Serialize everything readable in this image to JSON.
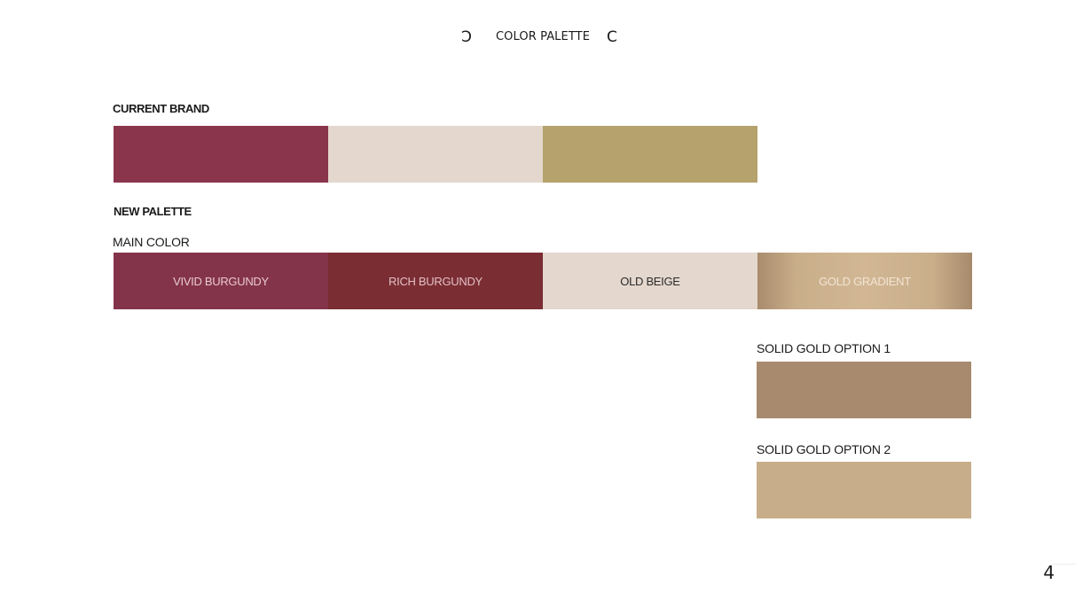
{
  "header": {
    "title": "COLOR PALETTE",
    "left_bracket": "Ↄ",
    "right_bracket": "C"
  },
  "current_brand": {
    "label": "CURRENT BRAND",
    "swatches": [
      {
        "name": "",
        "color": "#8a354c"
      },
      {
        "name": "",
        "color": "#e4d7cd"
      },
      {
        "name": "",
        "color": "#b5a26c"
      }
    ]
  },
  "new_palette": {
    "label": "NEW PALETTE",
    "main_color_label": "MAIN COLOR",
    "swatches": [
      {
        "name": "VIVID BURGUNDY",
        "color": "#84344a",
        "text_color": "#e8c9d0"
      },
      {
        "name": "RICH BURGUNDY",
        "color": "#7b2d34",
        "text_color": "#e1c0c3"
      },
      {
        "name": "OLD BEIGE",
        "color": "#e4d7cd",
        "text_color": "#2b2b2b"
      },
      {
        "name": "GOLD GRADIENT",
        "color": "#c6ab87",
        "text_color": "#f1e4d3"
      }
    ]
  },
  "solid_gold_option_1": {
    "label": "SOLID GOLD OPTION 1",
    "color": "#a88a6e"
  },
  "solid_gold_option_2": {
    "label": "SOLID GOLD OPTION 2",
    "color": "#c8ad8b"
  },
  "page_number": "4"
}
